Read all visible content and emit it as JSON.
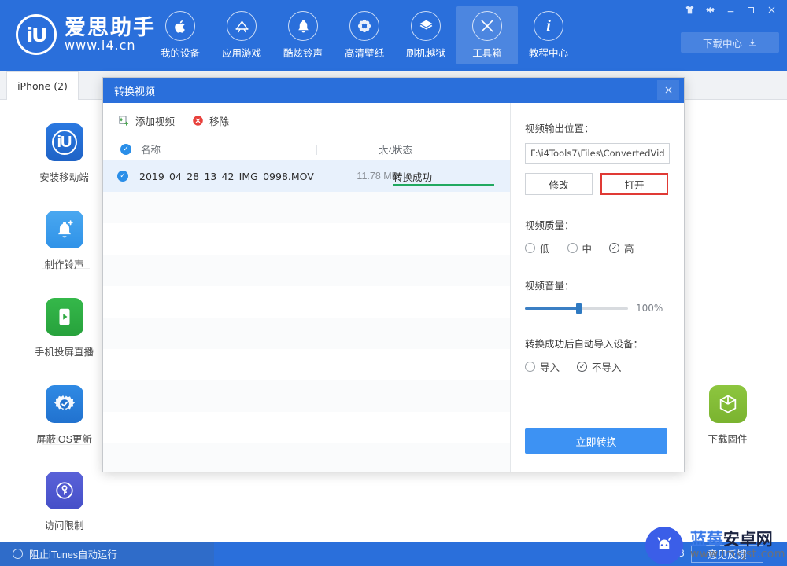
{
  "app": {
    "brand_cn": "爱思助手",
    "brand_url": "www.i4.cn",
    "logo_mark": "iU",
    "accent": "#2a6fdb",
    "download_center": "下载中心",
    "download_icon": "download-icon"
  },
  "window_controls": [
    {
      "name": "skin-icon",
      "glyph": "♟"
    },
    {
      "name": "settings-icon",
      "glyph": "⚙"
    },
    {
      "name": "minimize-icon",
      "glyph": "–"
    },
    {
      "name": "maximize-icon",
      "glyph": "□"
    },
    {
      "name": "close-icon",
      "glyph": "✕"
    }
  ],
  "nav": {
    "items": [
      {
        "label": "我的设备",
        "icon": "apple-icon",
        "glyph": "",
        "active": false
      },
      {
        "label": "应用游戏",
        "icon": "appstore-icon",
        "glyph": "A",
        "active": false
      },
      {
        "label": "酷炫铃声",
        "icon": "bell-icon",
        "glyph": "ὑ4",
        "active": false
      },
      {
        "label": "高清壁纸",
        "icon": "flower-icon",
        "glyph": "✿",
        "active": false
      },
      {
        "label": "刷机越狱",
        "icon": "flash-icon",
        "glyph": "❖",
        "active": false
      },
      {
        "label": "工具箱",
        "icon": "toolbox-icon",
        "glyph": "⚒",
        "active": true
      },
      {
        "label": "教程中心",
        "icon": "info-icon",
        "glyph": "i",
        "active": false
      }
    ]
  },
  "tabs": [
    {
      "label": "iPhone (2)",
      "active": true
    }
  ],
  "tools": [
    {
      "label": "安装移动端",
      "icon": "i4-app-icon",
      "color1": "#2a78e0",
      "color2": "#1f63c6",
      "glyph": "iU"
    },
    {
      "label": "制作铃声",
      "icon": "ringtone-icon",
      "color1": "#4aa8f0",
      "color2": "#2f92e8",
      "glyph": "ὑ4"
    },
    {
      "label": "手机投屏直播",
      "icon": "screencast-icon",
      "color1": "#35b84a",
      "color2": "#27a23c",
      "glyph": "▶"
    },
    {
      "label": "屏蔽iOS更新",
      "icon": "block-update-icon",
      "color1": "#2f8ae4",
      "color2": "#2172cf",
      "glyph": "⚙"
    },
    {
      "label": "访问限制",
      "icon": "restrictions-icon",
      "color1": "#5a62d8",
      "color2": "#454fc8",
      "glyph": "⚿"
    },
    {
      "label": "下载固件",
      "icon": "firmware-icon",
      "color1": "#8dc63f",
      "color2": "#7ab32f",
      "glyph": "⬡"
    }
  ],
  "dialog": {
    "title": "转换视频",
    "close_icon": "close-icon",
    "toolbar": [
      {
        "label": "添加视频",
        "icon": "add-video-icon"
      },
      {
        "label": "移除",
        "icon": "remove-icon"
      }
    ],
    "list": {
      "columns": {
        "name": "名称",
        "size": "大小",
        "state": "状态"
      },
      "rows": [
        {
          "name": "2019_04_28_13_42_IMG_0998.MOV",
          "size": "11.78 MB",
          "state": "转换成功",
          "selected": true,
          "progress": 100
        }
      ]
    },
    "output": {
      "label": "视频输出位置：",
      "path": "F:\\i4Tools7\\Files\\ConvertedVid",
      "modify_label": "修改",
      "open_label": "打开",
      "highlight_color": "#e03a35"
    },
    "quality": {
      "label": "视频质量：",
      "options": [
        {
          "label": "低",
          "selected": false
        },
        {
          "label": "中",
          "selected": false
        },
        {
          "label": "高",
          "selected": true
        }
      ]
    },
    "volume": {
      "label": "视频音量：",
      "value": "100%",
      "knob_pct": 52
    },
    "auto_import": {
      "label": "转换成功后自动导入设备：",
      "options": [
        {
          "label": "导入",
          "selected": false
        },
        {
          "label": "不导入",
          "selected": true
        }
      ]
    },
    "convert_button": "立即转换"
  },
  "statusbar": {
    "itunes_label": "阻止iTunes自动运行",
    "version": "V7.93",
    "feedback": "意见反馈"
  },
  "watermark": {
    "cn_blue": "蓝莓",
    "cn_dark": "安卓网",
    "url": "www.lmkjst.com",
    "logo_icon": "android-logo-icon"
  }
}
